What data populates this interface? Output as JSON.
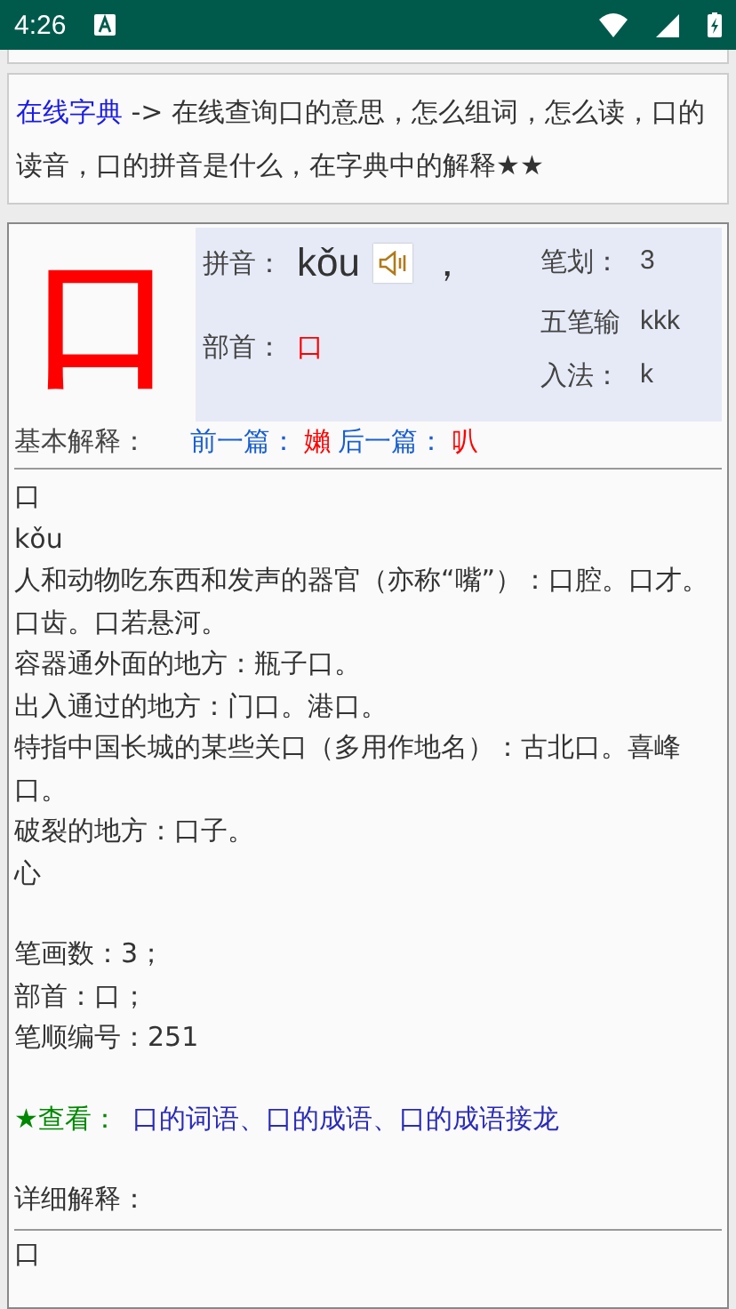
{
  "status_bar": {
    "time": "4:26"
  },
  "intro": {
    "link": "在线字典",
    "text": " -> 在线查询口的意思，怎么组词，怎么读，口的读音，口的拼音是什么，在字典中的解释★★"
  },
  "entry": {
    "character": "口",
    "pinyin_label": "拼音：",
    "pinyin": "kǒu",
    "pinyin_sep": "，",
    "radical_label": "部首：",
    "radical": "口",
    "facts": [
      {
        "label": "笔划：",
        "value": "3"
      },
      {
        "label": "五笔输入法：",
        "value": "kkkk"
      }
    ]
  },
  "nav": {
    "label": "基本解释：",
    "prev_label": "前一篇：",
    "prev": "嬾",
    "next_label": "后一篇：",
    "next": "叭"
  },
  "basic_lines": [
    "口",
    "kǒu",
    "人和动物吃东西和发声的器官（亦称“嘴”）：口腔。口才。口齿。口若悬河。",
    "容器通外面的地方：瓶子口。",
    "出入通过的地方：门口。港口。",
    "特指中国长城的某些关口（多用作地名）：古北口。喜峰口。",
    "破裂的地方：口子。",
    "心"
  ],
  "stats": [
    "笔画数：3；",
    "部首：口；",
    "笔顺编号：251"
  ],
  "see_also": {
    "label": "★查看：",
    "separator": "、",
    "links": [
      "口的词语",
      "口的成语",
      "口的成语接龙"
    ]
  },
  "detail": {
    "label": "详细解释：",
    "lines": [
      "口"
    ]
  }
}
